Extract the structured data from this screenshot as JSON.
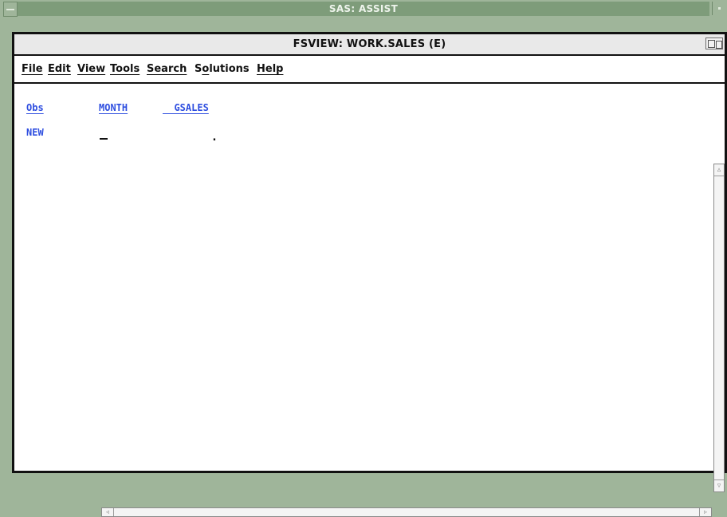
{
  "app_window": {
    "title": "SAS: ASSIST"
  },
  "fsview_window": {
    "title": "FSVIEW:  WORK.SALES (E)"
  },
  "menubar": {
    "items": [
      {
        "label": "File",
        "mnemonic_index": 0
      },
      {
        "label": "Edit",
        "mnemonic_index": 0
      },
      {
        "label": "View",
        "mnemonic_index": 0
      },
      {
        "label": "Tools",
        "mnemonic_index": 0
      },
      {
        "label": "Search",
        "mnemonic_index": 0
      },
      {
        "label": "Solutions",
        "mnemonic_index": 1
      },
      {
        "label": "Help",
        "mnemonic_index": 0
      }
    ]
  },
  "table": {
    "columns": [
      "Obs",
      "MONTH",
      "GSALES"
    ],
    "gsales_header_text": "  GSALES",
    "rows": [
      {
        "obs": "NEW",
        "month": "",
        "gsales": "."
      }
    ]
  },
  "colors": {
    "field_text": "#2f4fe0",
    "outer_frame": "#9fb59a",
    "title_bar": "#7e9c7a"
  },
  "icons": {
    "system_menu": "system-menu-icon",
    "minimize": "minimize-icon",
    "restore": "restore-icon",
    "scroll_up": "scroll-up-arrow-icon",
    "scroll_down": "scroll-down-arrow-icon",
    "scroll_left": "scroll-left-arrow-icon",
    "scroll_right": "scroll-right-arrow-icon"
  }
}
